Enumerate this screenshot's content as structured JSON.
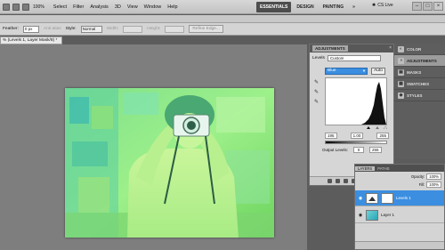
{
  "app": {
    "zoom": "100%"
  },
  "menu": {
    "items": [
      "Select",
      "Filter",
      "Analysis",
      "3D",
      "View",
      "Window",
      "Help"
    ]
  },
  "workspaces": {
    "tabs": [
      "ESSENTIALS",
      "DESIGN",
      "PAINTING",
      "»"
    ],
    "active": "ESSENTIALS",
    "cslive": "CS Live"
  },
  "window_buttons": {
    "minimize": "–",
    "maximize": "□",
    "close": "×"
  },
  "options": {
    "feather_label": "Feather:",
    "feather_value": "0 px",
    "antialias_label": "Anti-alias",
    "style_label": "Style:",
    "style_value": "Normal",
    "width_label": "Width:",
    "height_label": "Height:",
    "refine_edge": "Refine Edge..."
  },
  "document": {
    "tab_title": "% (Levels 1, Layer Mask/8) *"
  },
  "adjustments": {
    "tab": "ADJUSTMENTS",
    "close": "×",
    "levels_label": "Levels",
    "preset": "Custom",
    "channel": "Blue",
    "auto": "Auto",
    "input_black": "195",
    "input_mid": "1.00",
    "input_white": "255",
    "output_label": "Output Levels:",
    "output_black": "0",
    "output_white": "255"
  },
  "dock": {
    "items": [
      {
        "label": "COLOR",
        "icon": "color-icon"
      },
      {
        "label": "ADJUSTMENTS",
        "icon": "adjustments-icon"
      },
      {
        "label": "MASKS",
        "icon": "masks-icon"
      },
      {
        "label": "SWATCHES",
        "icon": "swatches-icon"
      },
      {
        "label": "STYLES",
        "icon": "styles-icon"
      }
    ]
  },
  "layers": {
    "tabs": [
      "LAYERS",
      "PATHS"
    ],
    "opacity_label": "Opacity:",
    "opacity": "100%",
    "fill_label": "Fill:",
    "fill": "100%",
    "items": [
      {
        "name": "Levels 1"
      },
      {
        "name": "Layer 1"
      }
    ]
  },
  "colors": {
    "accent": "#3b8ee0",
    "photo_tint": "#8be06a"
  }
}
